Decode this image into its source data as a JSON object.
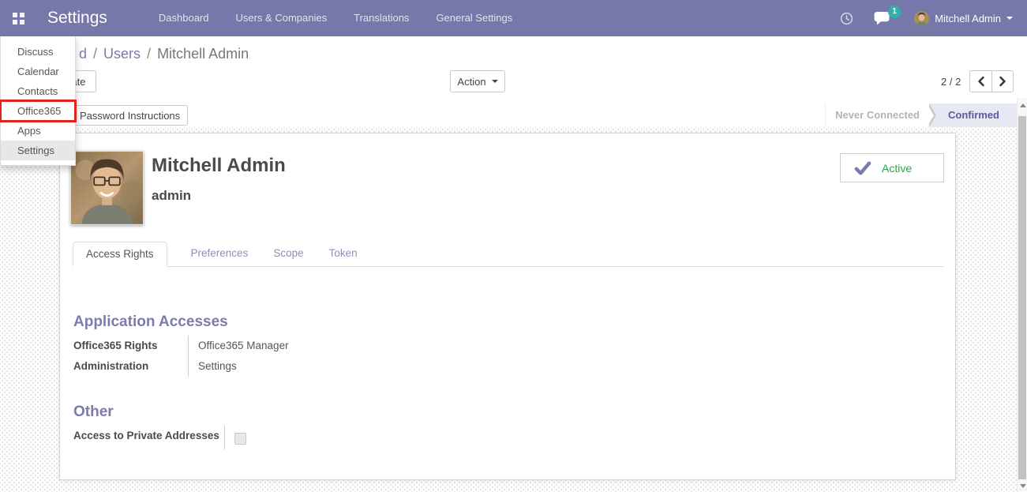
{
  "colors": {
    "navbar_bg": "#7578a9",
    "accent_purple": "#7c7bad",
    "badge_teal": "#32b2a7",
    "highlight_red": "#e32219",
    "active_green": "#28a745",
    "statusbar_active_bg": "#e6e9f1"
  },
  "icons": {
    "apps_menu": "grid-icon",
    "activities": "clock-icon",
    "messages": "chat-bubble-icon",
    "user_caret": "caret-down-icon",
    "pager_prev": "chevron-left-icon",
    "pager_next": "chevron-right-icon",
    "active_check": "check-icon",
    "scrollbar": "triangle-up-down-icons"
  },
  "navbar": {
    "app_title": "Settings",
    "menu": [
      {
        "label": "Dashboard"
      },
      {
        "label": "Users & Companies"
      },
      {
        "label": "Translations"
      },
      {
        "label": "General Settings"
      }
    ],
    "messages_badge": "1",
    "user_name": "Mitchell Admin"
  },
  "apps_dropdown": {
    "items": [
      {
        "label": "Discuss",
        "highlighted": false,
        "hovered": false
      },
      {
        "label": "Calendar",
        "highlighted": false,
        "hovered": false
      },
      {
        "label": "Contacts",
        "highlighted": false,
        "hovered": false
      },
      {
        "label": "Office365",
        "highlighted": true,
        "hovered": false
      },
      {
        "label": "Apps",
        "highlighted": false,
        "hovered": false
      },
      {
        "label": "Settings",
        "highlighted": false,
        "hovered": true
      }
    ]
  },
  "breadcrumb": {
    "partial_crumb": "d",
    "separator": "/",
    "parent_crumb": "Users",
    "current_crumb": "Mitchell Admin"
  },
  "actions": {
    "create_label": "Create",
    "action_label": "Action",
    "pager_value": "2 / 2"
  },
  "statusbar": {
    "password_button_label": "Password Instructions",
    "states": [
      {
        "label": "Never Connected",
        "active": false
      },
      {
        "label": "Confirmed",
        "active": true
      }
    ]
  },
  "user_form": {
    "name": "Mitchell Admin",
    "login": "admin",
    "active_button_label": "Active",
    "tabs": [
      {
        "label": "Access Rights",
        "active": true
      },
      {
        "label": "Preferences",
        "active": false
      },
      {
        "label": "Scope",
        "active": false
      },
      {
        "label": "Token",
        "active": false
      }
    ],
    "application_accesses": {
      "title": "Application Accesses",
      "fields": [
        {
          "label": "Office365 Rights",
          "value": "Office365 Manager"
        },
        {
          "label": "Administration",
          "value": "Settings"
        }
      ]
    },
    "other": {
      "title": "Other",
      "fields": [
        {
          "label": "Access to Private Addresses",
          "type": "checkbox",
          "checked": false
        }
      ]
    }
  }
}
